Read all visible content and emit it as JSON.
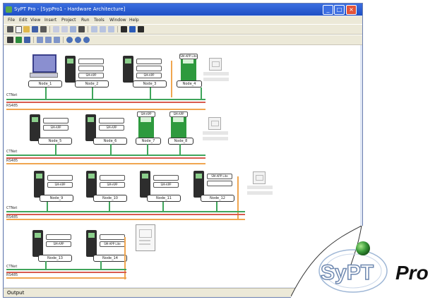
{
  "window": {
    "title": "SyPT Pro - [SypPro1 - Hardware Architecture]",
    "minimize": "_",
    "maximize": "□",
    "close": "×"
  },
  "menus": [
    "File",
    "Edit",
    "View",
    "Insert",
    "Project",
    "Run",
    "Tools",
    "Window",
    "Help"
  ],
  "statusbar": {
    "text": "Output"
  },
  "networks": [
    {
      "label_a": "CTNet",
      "label_b": "RS485",
      "nodes": [
        {
          "type": "pc",
          "label": "Node_1"
        },
        {
          "type": "drive",
          "label": "Node_2",
          "slot": "SM-APP"
        },
        {
          "type": "drive",
          "label": "Node_3",
          "slot": "SM-APP"
        },
        {
          "type": "drive-green",
          "label": "Node_4",
          "slot": "SM-APP Lite"
        }
      ]
    },
    {
      "label_a": "CTNet",
      "label_b": "RS485",
      "nodes": [
        {
          "type": "drive",
          "label": "Node_5",
          "slot": "SM-APP"
        },
        {
          "type": "drive",
          "label": "Node_6",
          "slot": "SM-APP"
        },
        {
          "type": "drive-green",
          "label": "Node_7",
          "slot": "SM-APP"
        },
        {
          "type": "drive-green",
          "label": "Node_8",
          "slot": "SM-APP"
        }
      ]
    },
    {
      "label_a": "CTNet",
      "label_b": "RS485",
      "nodes": [
        {
          "type": "drive",
          "label": "Node_9",
          "slot": "SM-APP"
        },
        {
          "type": "drive",
          "label": "Node_10",
          "slot": "SM-APP"
        },
        {
          "type": "drive",
          "label": "Node_11",
          "slot": "SM-APP"
        },
        {
          "type": "drive",
          "label": "Node_12",
          "slot": "SM-APP Lite"
        }
      ]
    },
    {
      "label_a": "CTNet",
      "label_b": "RS485",
      "nodes": [
        {
          "type": "drive",
          "label": "Node_13",
          "slot": "SM-APP"
        },
        {
          "type": "drive",
          "label": "Node_14",
          "slot": "SM-APP Lite"
        }
      ]
    }
  ],
  "logo": {
    "text_sy": "SyPT",
    "text_pro": "Pro"
  },
  "colors": {
    "bus_green": "#3fa55b",
    "bus_orange": "#f0a650",
    "bus_red": "#d85b4f",
    "titlebar": "#1e4fc4"
  }
}
